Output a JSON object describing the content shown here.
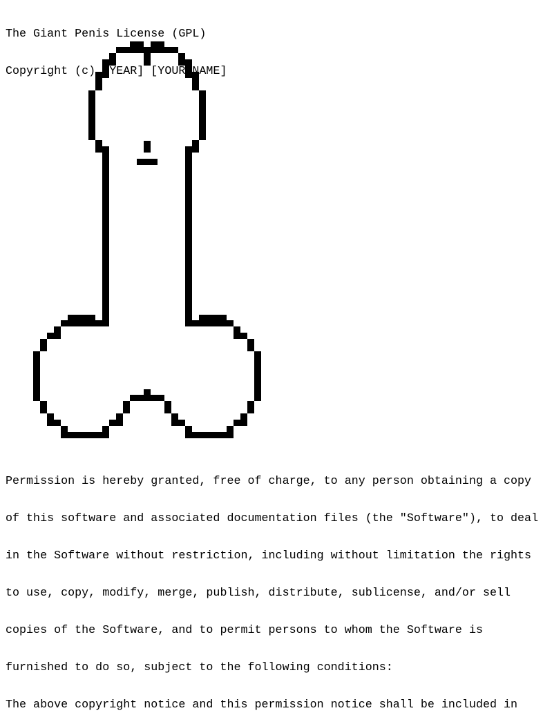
{
  "header": {
    "title": "The Giant Penis License (GPL)",
    "copyright": "Copyright (c) [YEAR] [YOUR NAME]"
  },
  "art": {
    "description_icon": "ascii-pixel-art",
    "color": "#000000"
  },
  "license": {
    "lines": [
      "Permission is hereby granted, free of charge, to any person obtaining a copy",
      "of this software and associated documentation files (the \"Software\"), to deal",
      "in the Software without restriction, including without limitation the rights",
      "to use, copy, modify, merge, publish, distribute, sublicense, and/or sell",
      "copies of the Software, and to permit persons to whom the Software is",
      "furnished to do so, subject to the following conditions:",
      "The above copyright notice and this permission notice shall be included in"
    ]
  }
}
